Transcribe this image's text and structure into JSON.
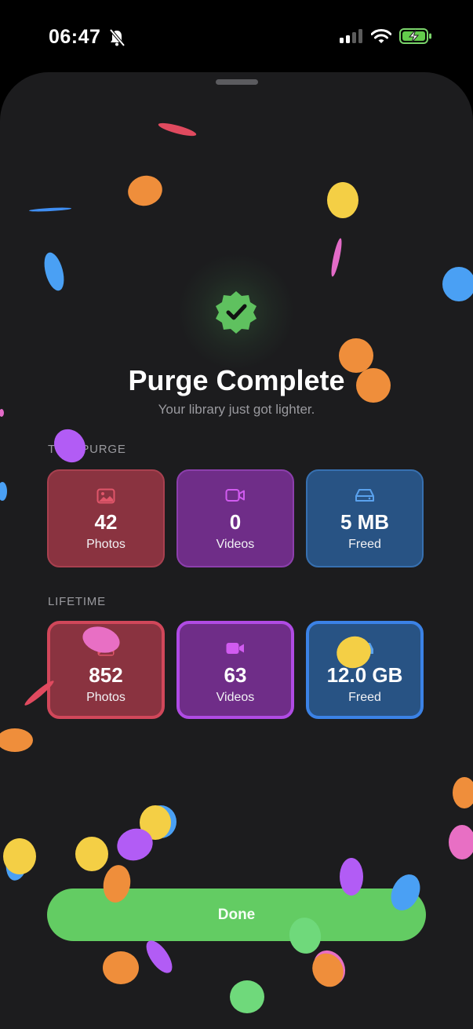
{
  "status_bar": {
    "time": "06:47",
    "icons": [
      "bell-slash-icon",
      "signal-icon",
      "wifi-icon",
      "battery-charging-icon"
    ]
  },
  "hero": {
    "icon": "checkmark-seal-icon",
    "title": "Purge Complete",
    "subtitle": "Your library just got lighter."
  },
  "this_purge": {
    "label": "THIS PURGE",
    "cards": [
      {
        "value": "42",
        "label": "Photos",
        "icon": "photo-icon"
      },
      {
        "value": "0",
        "label": "Videos",
        "icon": "video-camera-icon"
      },
      {
        "value": "5 MB",
        "label": "Freed",
        "icon": "drive-icon"
      }
    ]
  },
  "lifetime": {
    "label": "LIFETIME",
    "cards": [
      {
        "value": "852",
        "label": "Photos",
        "icon": "photo-icon"
      },
      {
        "value": "63",
        "label": "Videos",
        "icon": "video-camera-icon"
      },
      {
        "value": "12.0 GB",
        "label": "Freed",
        "icon": "drive-icon"
      }
    ]
  },
  "done_button": {
    "label": "Done"
  },
  "colors": {
    "accent_green": "#63cc63",
    "photos": "#8a3340",
    "videos": "#6f2d88",
    "freed": "#285384",
    "background": "#1c1c1e"
  }
}
